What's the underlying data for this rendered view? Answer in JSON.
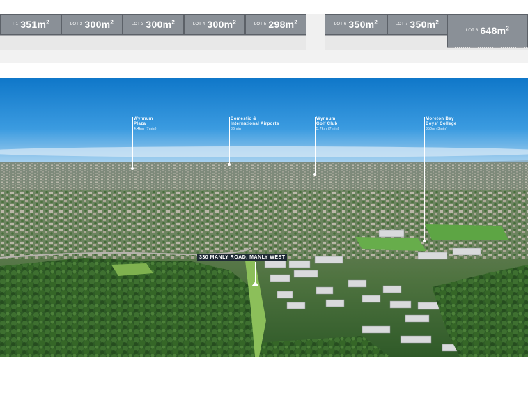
{
  "site_plan": {
    "lots": [
      {
        "number": "T 1",
        "area": "351m",
        "sup": "2"
      },
      {
        "number": "LOT 2",
        "area": "300m",
        "sup": "2"
      },
      {
        "number": "LOT 3",
        "area": "300m",
        "sup": "2"
      },
      {
        "number": "LOT 4",
        "area": "300m",
        "sup": "2"
      },
      {
        "number": "LOT 5",
        "area": "298m",
        "sup": "2"
      },
      {
        "number": "LOT 6",
        "area": "350m",
        "sup": "2"
      },
      {
        "number": "LOT 7",
        "area": "350m",
        "sup": "2"
      },
      {
        "number": "LOT 8",
        "area": "648m",
        "sup": "2"
      }
    ]
  },
  "aerial": {
    "callouts": [
      {
        "name": "Wynnum",
        "name2": "Plaza",
        "distance": "4.4km (7min)"
      },
      {
        "name": "Domestic &",
        "name2": "International Airports",
        "distance": "36min"
      },
      {
        "name": "Wynnum",
        "name2": "Golf Club",
        "distance": "5.7km (7min)"
      },
      {
        "name": "Moreton Bay",
        "name2": "Boys' College",
        "distance": "350m (3min)"
      }
    ],
    "address_label": "330 MANLY ROAD, MANLY WEST"
  }
}
